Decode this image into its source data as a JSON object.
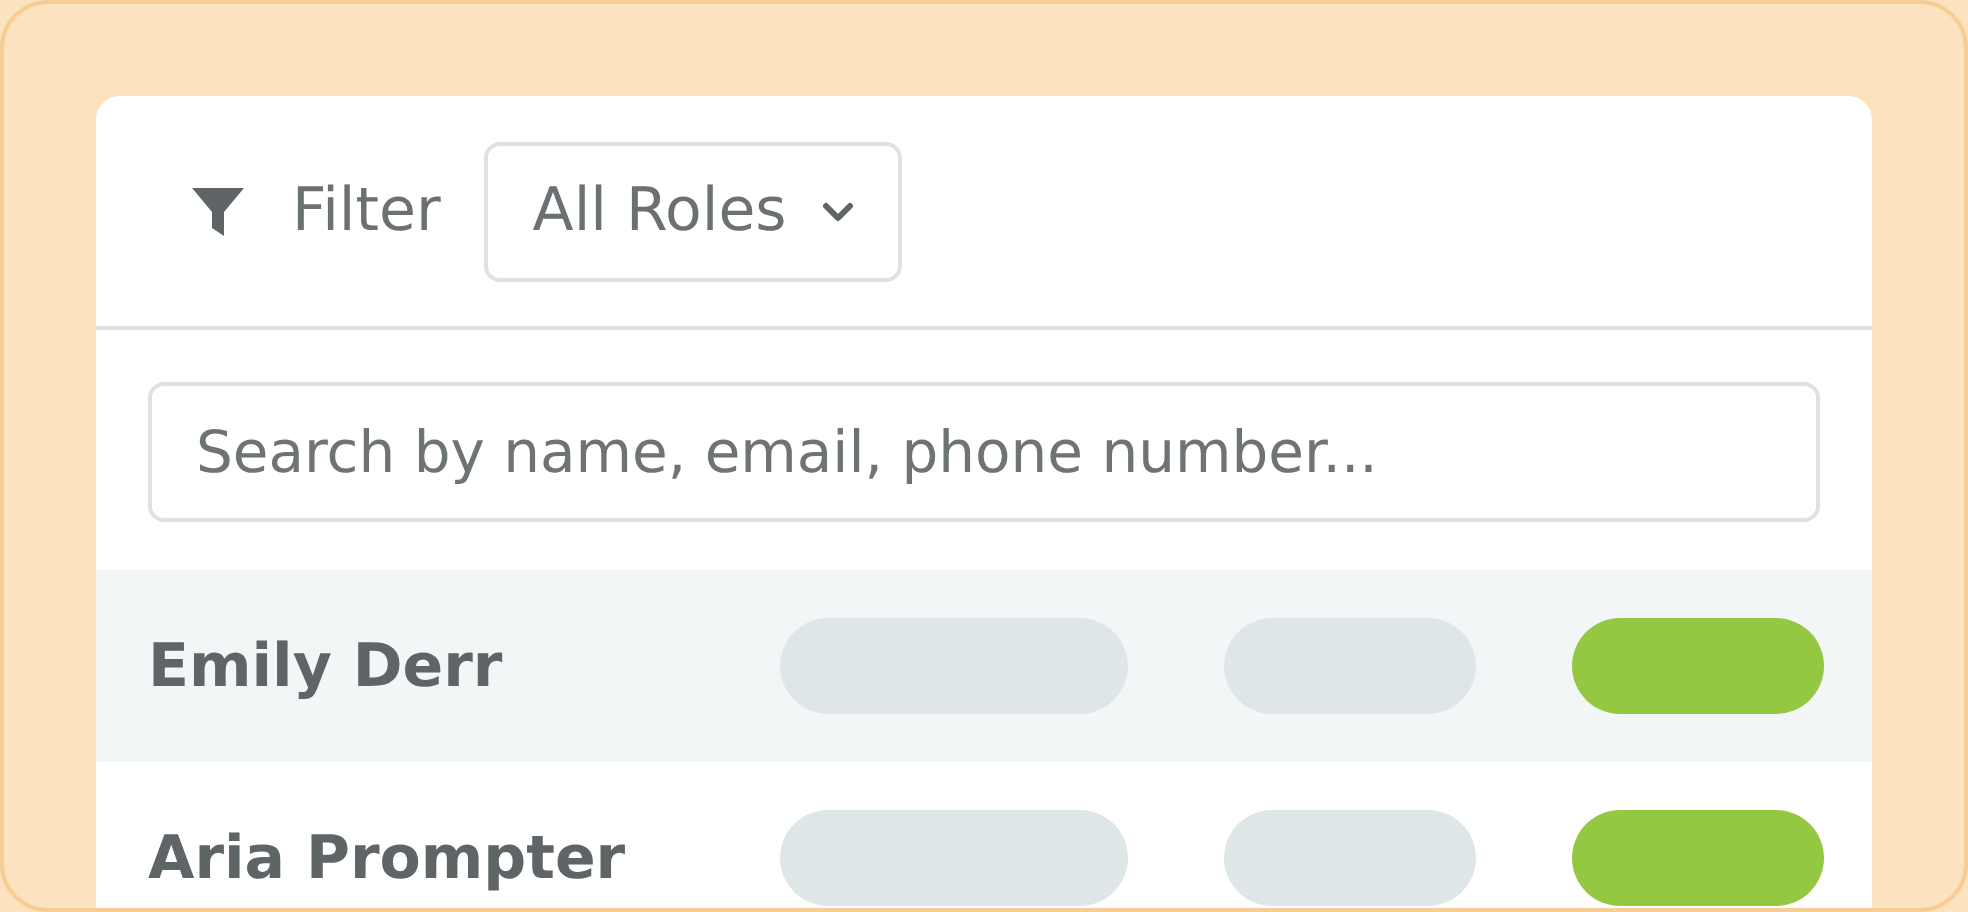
{
  "filter": {
    "label": "Filter",
    "dropdown": {
      "value": "All Roles"
    }
  },
  "search": {
    "placeholder": "Search by name, email, phone number..."
  },
  "rows": [
    {
      "name": "Emily Derr",
      "selected": true,
      "pills": [
        {
          "color": "#dfe6e8"
        },
        {
          "color": "#dfe6e8"
        },
        {
          "color": "#94c843"
        }
      ]
    },
    {
      "name": "Aria Prompter",
      "selected": false,
      "pills": [
        {
          "color": "#dfe6e8"
        },
        {
          "color": "#dfe6e8"
        },
        {
          "color": "#94c843"
        }
      ]
    }
  ]
}
